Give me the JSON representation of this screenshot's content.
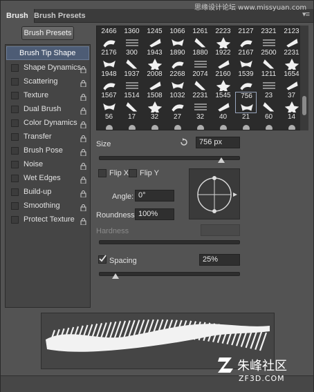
{
  "tabs": [
    {
      "label": "Brush",
      "active": true
    },
    {
      "label": "Brush Presets",
      "active": false
    }
  ],
  "watermark": "思缘设计论坛 www.missyuan.com",
  "brush_presets_button": "Brush Presets",
  "tip_shape_label": "Brush Tip Shape",
  "options": [
    {
      "label": "Shape Dynamics",
      "checked": false,
      "lock": true
    },
    {
      "label": "Scattering",
      "checked": false,
      "lock": true
    },
    {
      "label": "Texture",
      "checked": false,
      "lock": true
    },
    {
      "label": "Dual Brush",
      "checked": false,
      "lock": true
    },
    {
      "label": "Color Dynamics",
      "checked": false,
      "lock": true
    },
    {
      "label": "Transfer",
      "checked": false,
      "lock": true
    },
    {
      "label": "Brush Pose",
      "checked": false,
      "lock": true
    },
    {
      "label": "Noise",
      "checked": false,
      "lock": true
    },
    {
      "label": "Wet Edges",
      "checked": false,
      "lock": true
    },
    {
      "label": "Build-up",
      "checked": false,
      "lock": true
    },
    {
      "label": "Smoothing",
      "checked": false,
      "lock": true
    },
    {
      "label": "Protect Texture",
      "checked": false,
      "lock": true
    }
  ],
  "preset_rows": [
    [
      "2466",
      "1360",
      "1245",
      "1066",
      "1261",
      "2223",
      "2127",
      "2321",
      "2123"
    ],
    [
      "2176",
      "300",
      "1943",
      "1890",
      "1880",
      "1922",
      "2167",
      "2500",
      "2231"
    ],
    [
      "1948",
      "1937",
      "2008",
      "2268",
      "2074",
      "2160",
      "1539",
      "1211",
      "1654"
    ],
    [
      "1567",
      "1514",
      "1508",
      "1032",
      "2231",
      "1545",
      "756",
      "23",
      "37"
    ],
    [
      "56",
      "17",
      "32",
      "27",
      "32",
      "40",
      "21",
      "60",
      "14"
    ]
  ],
  "selected_preset": "756",
  "size": {
    "label": "Size",
    "value": "756 px",
    "slider_fraction": 0.87
  },
  "flip_x": {
    "label": "Flip X",
    "checked": false
  },
  "flip_y": {
    "label": "Flip Y",
    "checked": false
  },
  "angle": {
    "label": "Angle:",
    "value": "0°"
  },
  "roundness": {
    "label": "Roundness:",
    "value": "100%"
  },
  "hardness": {
    "label": "Hardness",
    "value": "",
    "enabled": false
  },
  "spacing": {
    "label": "Spacing",
    "checked": true,
    "value": "25%",
    "slider_fraction": 0.12
  },
  "logo_text": "朱峰社区",
  "logo_sub": "ZF3D.COM"
}
